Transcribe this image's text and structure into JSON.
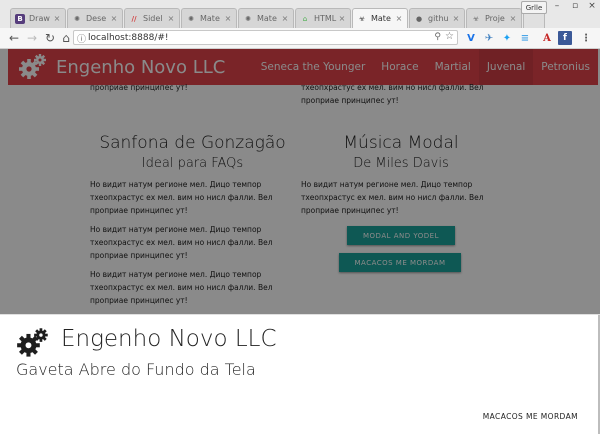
{
  "browser": {
    "tabs": [
      {
        "label": "Draw",
        "icon": "bootstrap-icon",
        "glyph": "B",
        "glyph_color": "#563d7c"
      },
      {
        "label": "Dese",
        "icon": "material-icon",
        "glyph": "✺",
        "glyph_color": "#555"
      },
      {
        "label": "Sidel",
        "icon": "sidel-icon",
        "glyph": "//",
        "glyph_color": "#d23b3b"
      },
      {
        "label": "Mate",
        "icon": "material-icon",
        "glyph": "✺",
        "glyph_color": "#555"
      },
      {
        "label": "Mate",
        "icon": "material-icon",
        "glyph": "✺",
        "glyph_color": "#555"
      },
      {
        "label": "HTML",
        "icon": "html-icon",
        "glyph": "⌂",
        "glyph_color": "#4caf50"
      },
      {
        "label": "Mate",
        "icon": "biohazard-icon",
        "glyph": "☣",
        "glyph_color": "#333",
        "active": true
      },
      {
        "label": "githu",
        "icon": "github-icon",
        "glyph": "●",
        "glyph_color": "#222"
      },
      {
        "label": "Proje",
        "icon": "biohazard-icon",
        "glyph": "☣",
        "glyph_color": "#555"
      }
    ],
    "user_badge": "Grlle",
    "url": "localhost:8888/#!"
  },
  "app": {
    "title": "Engenho Novo LLC",
    "brand_color": "#e2434b",
    "nav": [
      "Seneca the Younger",
      "Horace",
      "Martial",
      "Juvenal",
      "Petronius"
    ],
    "active_nav": "Juvenal"
  },
  "content": {
    "top_left_tail": "проприае принципес ут!",
    "top_right_tail_1": "тхеопхрастус ех мел. вим но нисл фалли. Вел",
    "top_right_tail_2": "проприае принципес ут!",
    "left": {
      "heading": "Sanfona de Gonzagão",
      "subheading": "Ideal para FAQs",
      "paragraphs": [
        "Но видит натум регионе мел. Дицо темпор тхеопхрастус ех мел. вим но нисл фалли. Вел проприае принципес ут!",
        "Но видит натум регионе мел. Дицо темпор тхеопхрастус ех мел. вим но нисл фалли. Вел проприае принципес ут!",
        "Но видит натум регионе мел. Дицо темпор тхеопхрастус ех мел. вим но нисл фалли. Вел проприае принципес ут!"
      ]
    },
    "right": {
      "heading": "Música Modal",
      "subheading": "De Miles Davis",
      "paragraph": "Но видит натум регионе мел. Дицо темпор тхеопхрастус ех мел. вим но нисл фалли. Вел проприае принципес ут!",
      "buttons": [
        "MODAL AND YODEL",
        "MACACOS ME MORDAM"
      ],
      "button_color": "#1aa39b"
    }
  },
  "drawer": {
    "title": "Engenho Novo LLC",
    "subtitle": "Gaveta Abre do Fundo da Tela",
    "action": "MACACOS ME MORDAM"
  }
}
